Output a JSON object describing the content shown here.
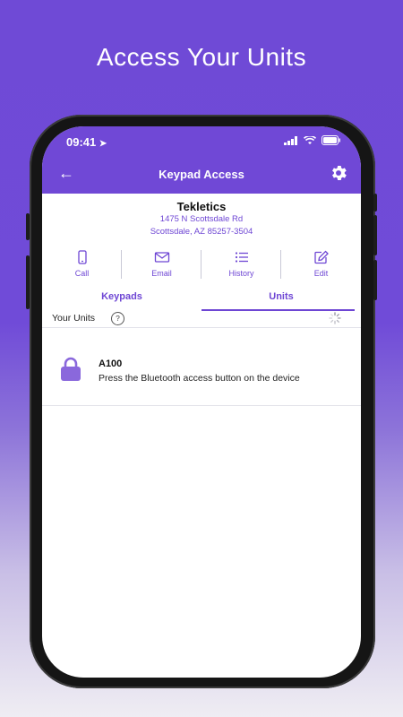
{
  "headline": "Access Your Units",
  "status": {
    "time": "09:41"
  },
  "nav": {
    "title": "Keypad Access"
  },
  "location": {
    "name": "Tekletics",
    "address_line1": "1475 N Scottsdale Rd",
    "address_line2": "Scottsdale, AZ 85257-3504"
  },
  "actions": [
    {
      "label": "Call",
      "icon": "phone-icon"
    },
    {
      "label": "Email",
      "icon": "mail-icon"
    },
    {
      "label": "History",
      "icon": "list-icon"
    },
    {
      "label": "Edit",
      "icon": "edit-icon"
    }
  ],
  "tabs": [
    {
      "label": "Keypads",
      "active": false
    },
    {
      "label": "Units",
      "active": true
    }
  ],
  "units_header": {
    "label": "Your Units",
    "help": "?"
  },
  "units": [
    {
      "name": "A100",
      "description": "Press the Bluetooth access button on the device"
    }
  ],
  "colors": {
    "accent": "#6e46d4",
    "topbar": "#7048d6",
    "lock": "#8a68dc"
  }
}
